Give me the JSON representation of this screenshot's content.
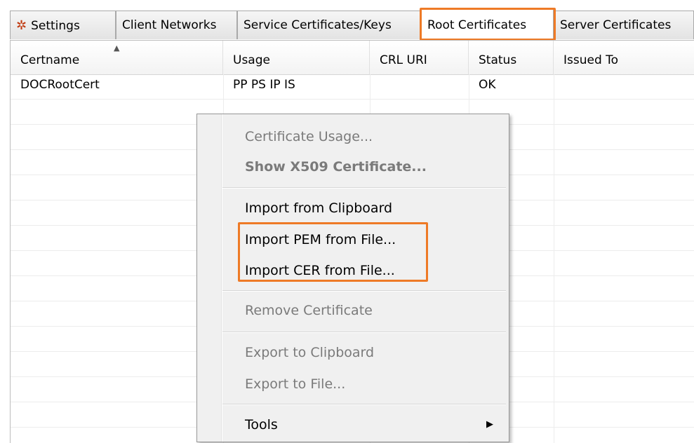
{
  "tabs": [
    {
      "label": "Settings",
      "icon": "settings-gear-icon"
    },
    {
      "label": "Client Networks"
    },
    {
      "label": "Service Certificates/Keys"
    },
    {
      "label": "Root Certificates",
      "active": true
    },
    {
      "label": "Server Certificates"
    }
  ],
  "table": {
    "columns": [
      "Certname",
      "Usage",
      "CRL URI",
      "Status",
      "Issued To"
    ],
    "sort_column": "Certname",
    "rows": [
      {
        "certname": "DOCRootCert",
        "usage": "PP PS IP IS",
        "crl_uri": "",
        "status": "OK",
        "issued_to": ""
      }
    ]
  },
  "context_menu": {
    "items": [
      {
        "label": "Certificate Usage...",
        "enabled": false
      },
      {
        "label": "Show X509 Certificate...",
        "enabled": false,
        "bold": true
      },
      {
        "label": "Import from Clipboard",
        "enabled": true
      },
      {
        "label": "Import PEM from File...",
        "enabled": true,
        "highlighted": true
      },
      {
        "label": "Import CER from File...",
        "enabled": true,
        "highlighted": true
      },
      {
        "label": "Remove Certificate",
        "enabled": false
      },
      {
        "label": "Export to Clipboard",
        "enabled": false
      },
      {
        "label": "Export to File...",
        "enabled": false
      },
      {
        "label": "Tools",
        "enabled": true,
        "has_submenu": true
      }
    ]
  },
  "colors": {
    "highlight": "#ee7a26",
    "disabled_text": "#7a7a7a",
    "menu_bg": "#f0f0f0"
  }
}
